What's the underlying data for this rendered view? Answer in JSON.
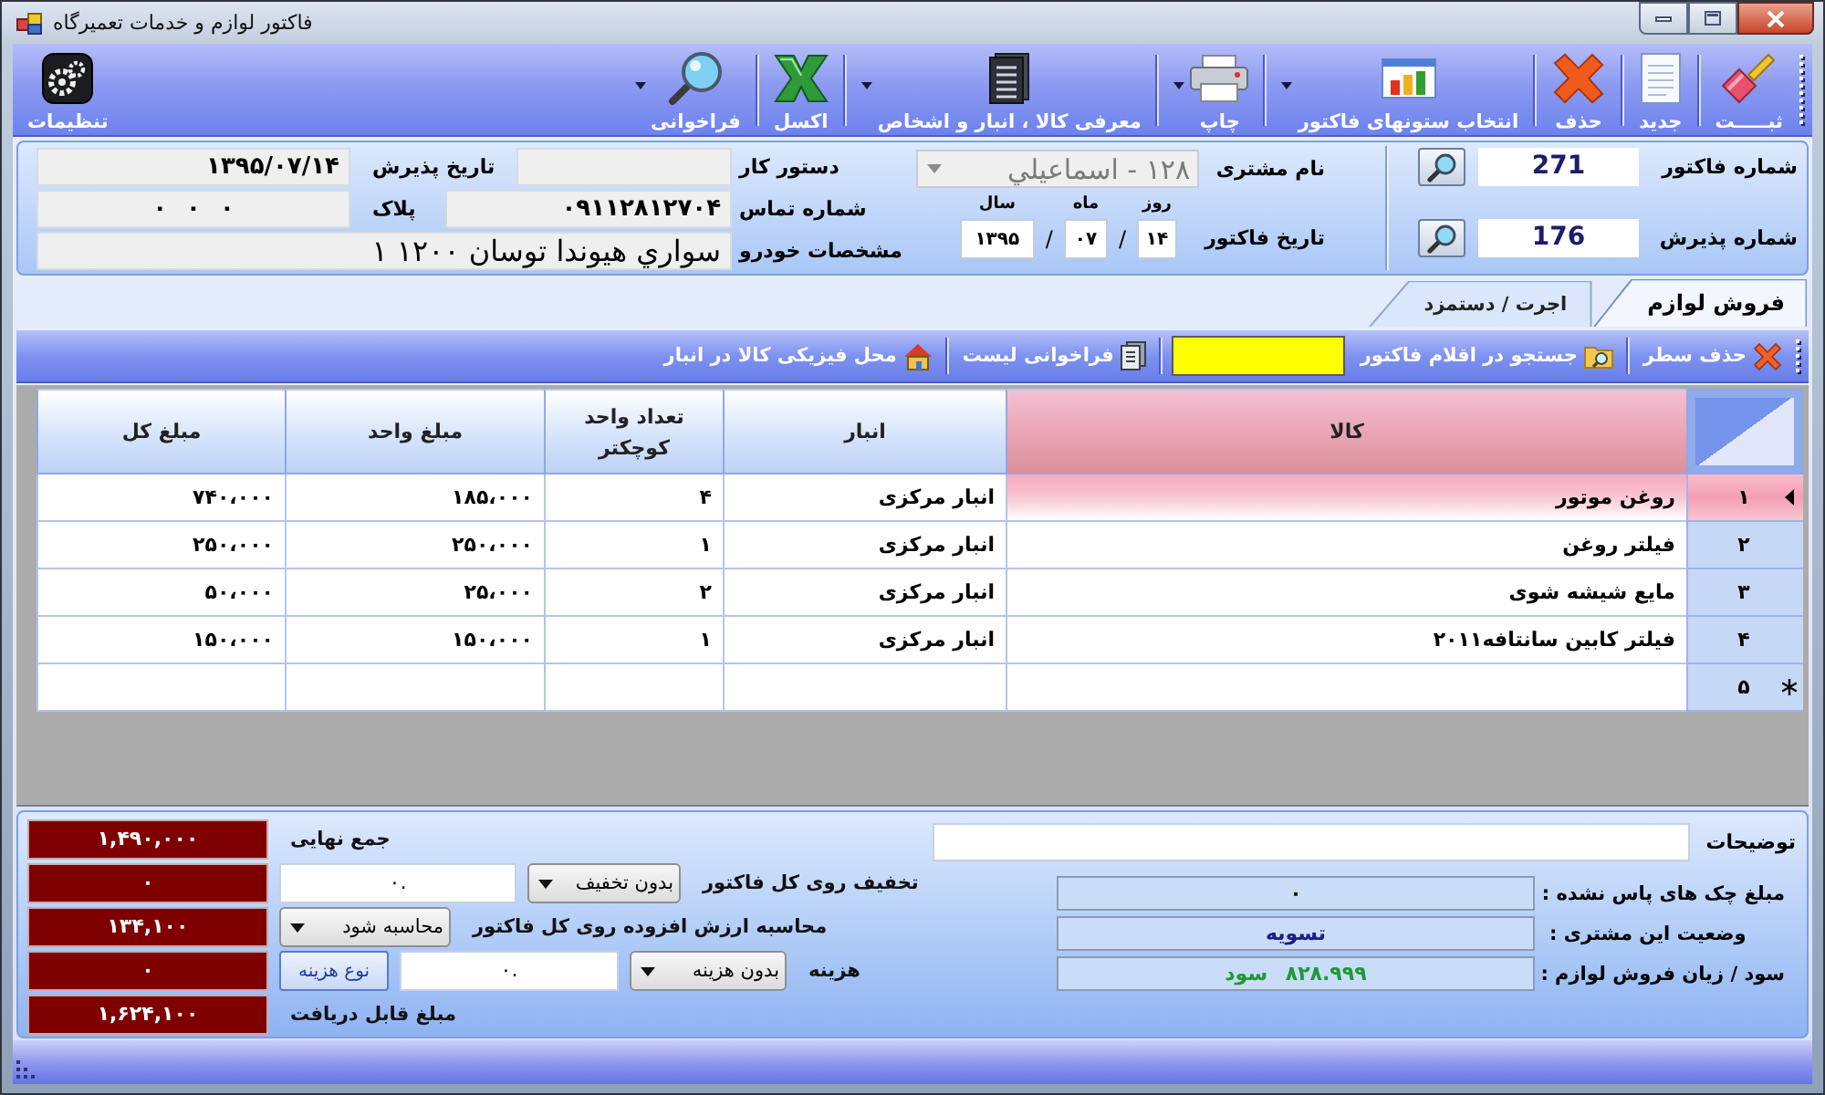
{
  "window": {
    "title": "فاکتور لوازم و خدمات تعمیرگاه"
  },
  "toolbar": {
    "buttons": [
      {
        "label": "ثبـــــت",
        "has_menu": false
      },
      {
        "label": "جدید",
        "has_menu": false
      },
      {
        "label": "حذف",
        "has_menu": false
      },
      {
        "label": "انتخاب ستونهای فاکتور",
        "has_menu": true
      },
      {
        "label": "چاپ",
        "has_menu": true
      },
      {
        "label": "معرفی کالا ، انبار و اشخاص",
        "has_menu": true
      },
      {
        "label": "اکسل",
        "has_menu": false
      },
      {
        "label": "فراخوانی",
        "has_menu": true
      }
    ],
    "settings": {
      "label": "تنظیمات"
    }
  },
  "header": {
    "invoice_number": {
      "label": "شماره فاکتور",
      "value": "271"
    },
    "reception_number": {
      "label": "شماره پذیرش",
      "value": "176"
    },
    "customer": {
      "label": "نام مشتری",
      "value": "۱۲۸ - اسماعيلي",
      "disabled": true
    },
    "invoice_date": {
      "label": "تاریخ فاکتور",
      "parts": [
        {
          "caption": "روز",
          "value": "۱۴"
        },
        {
          "caption": "ماه",
          "value": "۰۷"
        },
        {
          "caption": "سال",
          "value": "۱۳۹۵"
        }
      ],
      "separators": [
        "/",
        "/"
      ]
    },
    "work_order": {
      "label": "دستور کار"
    },
    "contact_number": {
      "label": "شماره تماس",
      "value": "۰۹۱۱۲۸۱۲۷۰۴"
    },
    "vehicle": {
      "label": "مشخصات خودرو",
      "value": "سواري هيوندا توسان ۱۲۰۰ ۱"
    },
    "reception_date": {
      "label": "تاریخ پذیرش",
      "value": "۱۳۹۵/۰۷/۱۴"
    },
    "plate": {
      "label": "پلاک",
      "value": "۰ ۰ ۰"
    }
  },
  "tabs": [
    {
      "label": "فروش لوازم",
      "selected": true
    },
    {
      "label": "اجرت / دستمزد",
      "selected": false
    }
  ],
  "grid_toolbar": [
    {
      "kind": "button",
      "label": "حذف سطر"
    },
    {
      "kind": "button",
      "label": "جستجو در اقلام فاکتور"
    },
    {
      "kind": "field"
    },
    {
      "kind": "button",
      "label": "فراخوانی لیست"
    },
    {
      "kind": "button",
      "label": "محل فیزیکی کالا در انبار"
    }
  ],
  "grid": {
    "columns": [
      {
        "label": "کالا",
        "selected": true
      },
      {
        "label": "انبار",
        "selected": false
      },
      {
        "label": "تعداد واحد کوچکتر",
        "selected": false
      },
      {
        "label": "مبلغ واحد",
        "selected": false
      },
      {
        "label": "مبلغ کل",
        "selected": false
      }
    ],
    "rows": [
      {
        "number": "۱",
        "selected": true,
        "new_row": false,
        "cells": [
          "روغن موتور",
          "انبار مرکزی",
          "۴",
          "۱۸۵،۰۰۰",
          "۷۴۰،۰۰۰"
        ]
      },
      {
        "number": "۲",
        "selected": false,
        "new_row": false,
        "cells": [
          "فیلتر روغن",
          "انبار مرکزی",
          "۱",
          "۲۵۰،۰۰۰",
          "۲۵۰،۰۰۰"
        ]
      },
      {
        "number": "۳",
        "selected": false,
        "new_row": false,
        "cells": [
          "مایع شیشه شوی",
          "انبار مرکزی",
          "۲",
          "۲۵،۰۰۰",
          "۵۰،۰۰۰"
        ]
      },
      {
        "number": "۴",
        "selected": false,
        "new_row": false,
        "cells": [
          "فیلتر کابین سانتافه۲۰۱۱",
          "انبار مرکزی",
          "۱",
          "۱۵۰،۰۰۰",
          "۱۵۰،۰۰۰"
        ]
      },
      {
        "number": "۵",
        "selected": false,
        "new_row": true
      }
    ]
  },
  "summary": {
    "notes": {
      "label": "توضیحات"
    },
    "customer_summary": [
      {
        "label": "مبلغ چک های پاس نشده :",
        "value": "۰",
        "color": "#000000"
      },
      {
        "label": "وضعیت این مشتری :",
        "value": "تسویه",
        "color": "#1c1c8a"
      },
      {
        "label": "سود / زیان فروش لوازم :",
        "value": "۸۲۸.۹۹۹ سود",
        "color": "#1e9a34"
      }
    ]
  },
  "totals": [
    {
      "kind": "total",
      "label": "جمع نهایی",
      "amount": "۱,۴۹۰,۰۰۰"
    },
    {
      "kind": "discount",
      "label": "تخفیف روی کل فاکتور",
      "option": "بدون تخفیف",
      "value": "۰.",
      "amount": "۰"
    },
    {
      "kind": "vat",
      "label": "محاسبه ارزش افزوده روی کل فاکتور",
      "option": "محاسبه شود",
      "amount": "۱۳۴,۱۰۰"
    },
    {
      "kind": "cost",
      "label": "هزینه",
      "option": "بدون هزینه",
      "value": "۰.",
      "button": "نوع هزینه",
      "amount": "۰"
    },
    {
      "kind": "payable",
      "label": "مبلغ قابل دریافت",
      "amount": "۱,۶۲۴,۱۰۰"
    }
  ]
}
